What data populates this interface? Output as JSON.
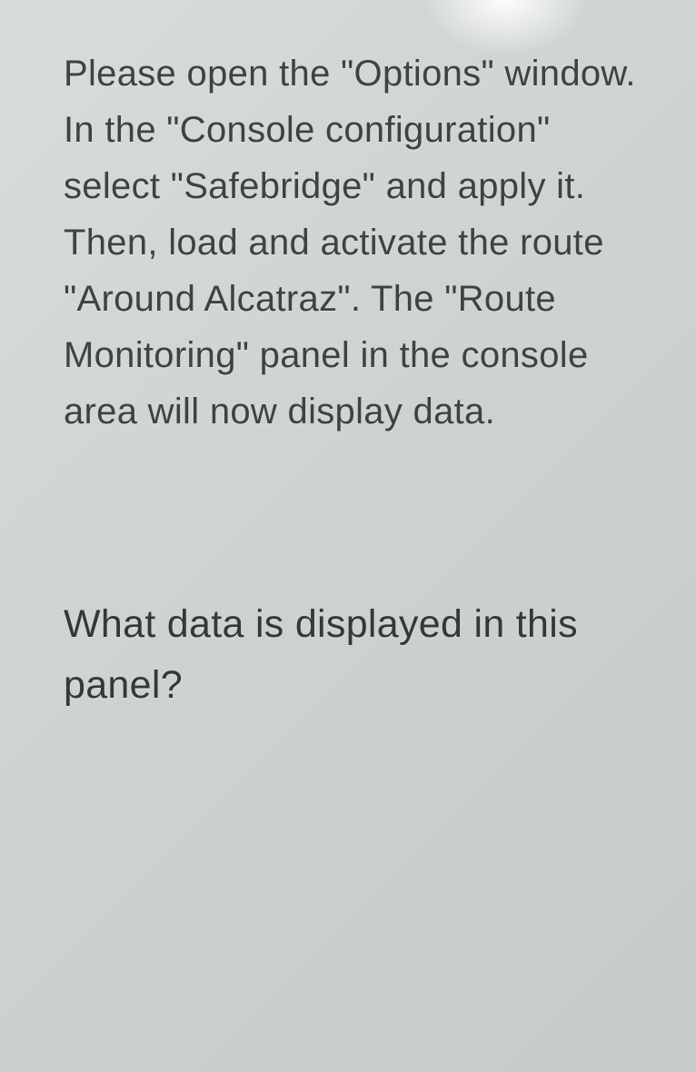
{
  "instruction_text": "Please open the \"Options\" window. In the \"Console configuration\" select \"Safebridge\" and apply it. Then, load and activate the route \"Around Alcatraz\". The \"Route Monitoring\" panel in the console area will now display data.",
  "question_text": "What data is displayed in this panel?"
}
